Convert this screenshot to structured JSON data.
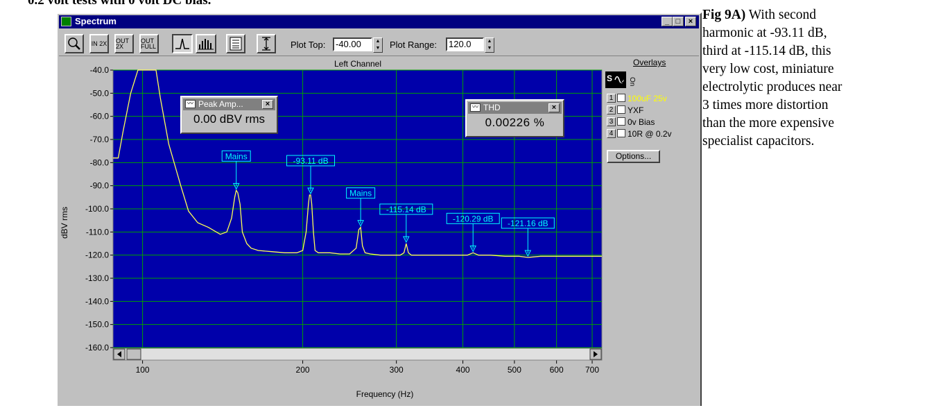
{
  "page": {
    "top_caption": "0.2 volt tests with 0 volt DC bias.",
    "side_caption": {
      "lead": "Fig 9A)",
      "lines": [
        " With second",
        "harmonic at -93.11 dB,",
        "third at -115.14 dB, this",
        "very low cost, miniature",
        "electrolytic produces near",
        "3 times more distortion",
        "than the more expensive",
        "specialist capacitors."
      ]
    }
  },
  "window": {
    "title": "Spectrum",
    "controls": [
      "_",
      "□",
      "×"
    ]
  },
  "toolbar": {
    "buttons": [
      {
        "name": "zoom-button",
        "icon": "magnifier-icon"
      },
      {
        "name": "zoom-in-2x-button",
        "label": "IN 2X"
      },
      {
        "name": "zoom-out-2x-button",
        "label": "OUT 2X"
      },
      {
        "name": "zoom-out-full-button",
        "label": "OUT FULL"
      },
      {
        "name": "line-plot-button",
        "icon": "line-plot-icon",
        "pressed": true
      },
      {
        "name": "bar-plot-button",
        "icon": "bar-plot-icon"
      },
      {
        "name": "data-table-button",
        "icon": "table-icon"
      },
      {
        "name": "autoscale-button",
        "icon": "vertical-range-icon"
      }
    ],
    "plot_top_label": "Plot Top:",
    "plot_top_value": "-40.00",
    "plot_range_label": "Plot Range:",
    "plot_range_value": "120.0"
  },
  "popups": {
    "peak": {
      "title": "Peak Amp...",
      "value": "0.00 dBV rms"
    },
    "thd": {
      "title": "THD",
      "value": "0.00226 %"
    }
  },
  "overlays": {
    "title": "Overlays",
    "col_set": "Set",
    "col_on": "On",
    "items": [
      {
        "num": "1",
        "label": "100uF 25v",
        "color": "#ffff00"
      },
      {
        "num": "2",
        "label": "YXF",
        "color": "#000000"
      },
      {
        "num": "3",
        "label": "0v Bias",
        "color": "#000000"
      },
      {
        "num": "4",
        "label": "10R @ 0.2v",
        "color": "#000000"
      }
    ],
    "options_label": "Options..."
  },
  "colors": {
    "plot_background": "#0000aa",
    "grid": "#00a000",
    "trace": "#ffff55",
    "marker": "#00ffff",
    "title_bar": "#000080"
  },
  "chart_data": {
    "type": "line",
    "title": "Left Channel",
    "xlabel": "Frequency (Hz)",
    "ylabel": "dBV rms",
    "x_scale": "log",
    "xlim": [
      88,
      730
    ],
    "ylim": [
      -160,
      -40
    ],
    "grid": true,
    "x_ticks": [
      100,
      200,
      300,
      400,
      500,
      600,
      700
    ],
    "y_ticks": [
      -40,
      -50,
      -60,
      -70,
      -80,
      -90,
      -100,
      -110,
      -120,
      -130,
      -140,
      -150,
      -160
    ],
    "y_tick_labels": [
      "-40.0",
      "-50.0",
      "-60.0",
      "-70.0",
      "-80.0",
      "-90.0",
      "-100.0",
      "-110.0",
      "-120.0",
      "-130.0",
      "-140.0",
      "-150.0",
      "-160.0"
    ],
    "series": [
      {
        "x": [
          88,
          90,
          92,
          95,
          98,
          100,
          104,
          106,
          108,
          112,
          118,
          122,
          127,
          133,
          140,
          144,
          147,
          149,
          150,
          151,
          152.5,
          154,
          157,
          160,
          165,
          175,
          185,
          195,
          200,
          203,
          205,
          206,
          207,
          208,
          209.5,
          211,
          214,
          218,
          225,
          235,
          245,
          252,
          255,
          257,
          259,
          262,
          268,
          280,
          295,
          305,
          310,
          313,
          316,
          320,
          330,
          350,
          370,
          390,
          408,
          418,
          428,
          450,
          480,
          510,
          530,
          560,
          600,
          650,
          700,
          730
        ],
        "y": [
          -78,
          -78,
          -66,
          -50,
          -40,
          -40,
          -40,
          -40,
          -52,
          -72,
          -90,
          -101,
          -106,
          -108,
          -111,
          -110,
          -104,
          -95,
          -92,
          -93,
          -98,
          -110,
          -115,
          -117,
          -118,
          -118.5,
          -119,
          -119,
          -118,
          -110,
          -98,
          -94,
          -94,
          -98,
          -110,
          -118,
          -119,
          -119,
          -119,
          -119.5,
          -119.5,
          -117,
          -109,
          -108,
          -116,
          -119,
          -119.5,
          -120,
          -120,
          -120,
          -119,
          -115,
          -119,
          -120,
          -120,
          -120,
          -120,
          -120,
          -120,
          -119,
          -120,
          -120,
          -120.5,
          -120.5,
          -121,
          -120.5,
          -120.5,
          -120.5,
          -120.5,
          -120.5
        ]
      }
    ],
    "markers": [
      {
        "label": "Mains",
        "x": 150,
        "y": -92
      },
      {
        "label": "-93.11 dB",
        "x": 207,
        "y": -94
      },
      {
        "label": "Mains",
        "x": 257,
        "y": -108
      },
      {
        "label": "-115.14 dB",
        "x": 313,
        "y": -115
      },
      {
        "label": "-120.29 dB",
        "x": 418,
        "y": -119
      },
      {
        "label": "-121.16 dB",
        "x": 530,
        "y": -121
      }
    ]
  }
}
